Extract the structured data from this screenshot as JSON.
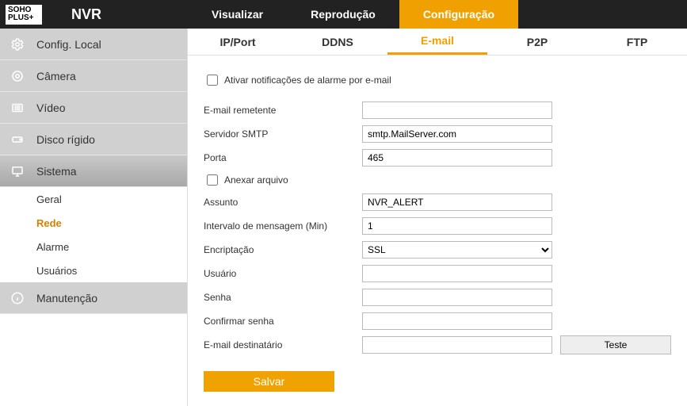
{
  "logo": {
    "line1": "SOHO",
    "line2": "PLUS+"
  },
  "brand": "NVR",
  "topnav": [
    {
      "label": "Visualizar",
      "active": false
    },
    {
      "label": "Reprodução",
      "active": false
    },
    {
      "label": "Configuração",
      "active": true
    }
  ],
  "sidebar": {
    "items": [
      {
        "icon": "gear",
        "label": "Config. Local"
      },
      {
        "icon": "camera",
        "label": "Câmera"
      },
      {
        "icon": "video",
        "label": "Vídeo"
      },
      {
        "icon": "disk",
        "label": "Disco rígido"
      },
      {
        "icon": "system",
        "label": "Sistema",
        "selected": true
      },
      {
        "icon": "info",
        "label": "Manutenção"
      }
    ],
    "subitems": [
      {
        "label": "Geral"
      },
      {
        "label": "Rede",
        "active": true
      },
      {
        "label": "Alarme"
      },
      {
        "label": "Usuários"
      }
    ]
  },
  "subtabs": [
    {
      "label": "IP/Port"
    },
    {
      "label": "DDNS"
    },
    {
      "label": "E-mail",
      "active": true
    },
    {
      "label": "P2P"
    },
    {
      "label": "FTP"
    }
  ],
  "form": {
    "enable_notifications_label": "Ativar notificações de alarme por e-mail",
    "sender_label": "E-mail remetente",
    "sender_value": "",
    "smtp_label": "Servidor SMTP",
    "smtp_value": "smtp.MailServer.com",
    "port_label": "Porta",
    "port_value": "465",
    "attach_label": "Anexar arquivo",
    "subject_label": "Assunto",
    "subject_value": "NVR_ALERT",
    "interval_label": "Intervalo de mensagem (Min)",
    "interval_value": "1",
    "encryption_label": "Encriptação",
    "encryption_value": "SSL",
    "user_label": "Usuário",
    "user_value": "",
    "password_label": "Senha",
    "password_value": "",
    "confirm_label": "Confirmar senha",
    "confirm_value": "",
    "recipient_label": "E-mail destinatário",
    "recipient_value": "",
    "test_button": "Teste",
    "save_button": "Salvar"
  }
}
